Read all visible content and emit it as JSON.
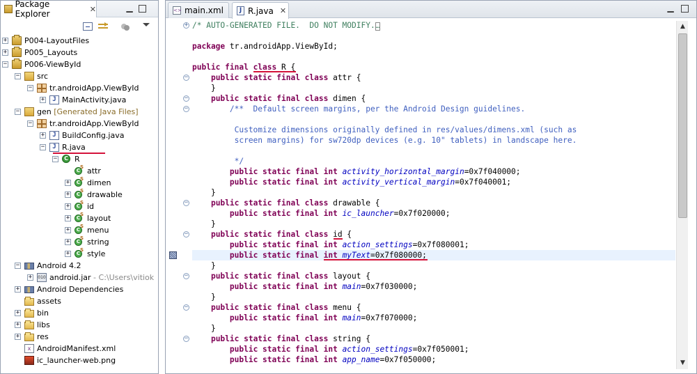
{
  "package_explorer": {
    "title": "Package Explorer",
    "tree": [
      {
        "level": 0,
        "toggle": "+",
        "icon": "project-icon",
        "label": "P004-LayoutFiles"
      },
      {
        "level": 0,
        "toggle": "+",
        "icon": "project-icon",
        "label": "P005_Layouts"
      },
      {
        "level": 0,
        "toggle": "-",
        "icon": "project-icon",
        "label": "P006-ViewById"
      },
      {
        "level": 1,
        "toggle": "-",
        "icon": "source-folder-icon",
        "label": "src"
      },
      {
        "level": 2,
        "toggle": "-",
        "icon": "package-icon",
        "label": "tr.androidApp.ViewById"
      },
      {
        "level": 3,
        "toggle": "+",
        "icon": "java-file-icon",
        "label": "MainActivity.java"
      },
      {
        "level": 1,
        "toggle": "-",
        "icon": "source-folder-icon",
        "label": "gen",
        "decoration": "[Generated Java Files]"
      },
      {
        "level": 2,
        "toggle": "-",
        "icon": "package-icon",
        "label": "tr.androidApp.ViewById"
      },
      {
        "level": 3,
        "toggle": "+",
        "icon": "java-file-icon",
        "label": "BuildConfig.java"
      },
      {
        "level": 3,
        "toggle": "-",
        "icon": "java-file-icon",
        "label": "R.java"
      },
      {
        "level": 4,
        "toggle": "-",
        "icon": "class-icon",
        "label": "R"
      },
      {
        "level": 5,
        "toggle": "",
        "icon": "inner-class-icon",
        "label": "attr"
      },
      {
        "level": 5,
        "toggle": "+",
        "icon": "inner-class-icon",
        "label": "dimen"
      },
      {
        "level": 5,
        "toggle": "+",
        "icon": "inner-class-icon",
        "label": "drawable"
      },
      {
        "level": 5,
        "toggle": "+",
        "icon": "inner-class-icon",
        "label": "id"
      },
      {
        "level": 5,
        "toggle": "+",
        "icon": "inner-class-icon",
        "label": "layout"
      },
      {
        "level": 5,
        "toggle": "+",
        "icon": "inner-class-icon",
        "label": "menu"
      },
      {
        "level": 5,
        "toggle": "+",
        "icon": "inner-class-icon",
        "label": "string"
      },
      {
        "level": 5,
        "toggle": "+",
        "icon": "inner-class-icon",
        "label": "style"
      },
      {
        "level": 1,
        "toggle": "-",
        "icon": "library-icon",
        "label": "Android 4.2"
      },
      {
        "level": 2,
        "toggle": "+",
        "icon": "jar-icon",
        "label": "android.jar",
        "decoration_grey": " - C:\\Users\\vitiok"
      },
      {
        "level": 1,
        "toggle": "+",
        "icon": "library-icon",
        "label": "Android Dependencies"
      },
      {
        "level": 1,
        "toggle": "",
        "icon": "folder-icon",
        "label": "assets"
      },
      {
        "level": 1,
        "toggle": "+",
        "icon": "folder-icon",
        "label": "bin"
      },
      {
        "level": 1,
        "toggle": "+",
        "icon": "folder-icon",
        "label": "libs"
      },
      {
        "level": 1,
        "toggle": "+",
        "icon": "folder-icon",
        "label": "res"
      },
      {
        "level": 1,
        "toggle": "",
        "icon": "xml-file-icon",
        "label": "AndroidManifest.xml"
      },
      {
        "level": 1,
        "toggle": "",
        "icon": "png-file-icon",
        "label": "ic_launcher-web.png"
      }
    ]
  },
  "editor": {
    "tabs": [
      {
        "label": "main.xml",
        "active": false
      },
      {
        "label": "R.java",
        "active": true
      }
    ],
    "lines": [
      [
        {
          "t": "/* AUTO-GENERATED FILE.  DO NOT MODIFY.",
          "c": "cmt"
        },
        {
          "t": "…",
          "c": "cmt"
        }
      ],
      [],
      [
        {
          "t": "package",
          "c": "kw"
        },
        {
          "t": " tr.androidApp.ViewById;",
          "c": ""
        }
      ],
      [],
      [
        {
          "t": "public final ",
          "c": "kw"
        },
        {
          "t": "class",
          "c": "kw"
        },
        {
          "t": " R {",
          "c": ""
        }
      ],
      [
        {
          "t": "    ",
          "c": ""
        },
        {
          "t": "public static final class",
          "c": "kw"
        },
        {
          "t": " attr {",
          "c": ""
        }
      ],
      [
        {
          "t": "    }",
          "c": ""
        }
      ],
      [
        {
          "t": "    ",
          "c": ""
        },
        {
          "t": "public static final class",
          "c": "kw"
        },
        {
          "t": " dimen {",
          "c": ""
        }
      ],
      [
        {
          "t": "        /**  Default screen margins, per the Android Design guidelines.",
          "c": "cm"
        }
      ],
      [],
      [
        {
          "t": "         Customize dimensions originally defined in res/values/dimens.xml (such as",
          "c": "cm"
        }
      ],
      [
        {
          "t": "         screen margins) for sw720dp devices (e.g. 10\" tablets) in landscape here.",
          "c": "cm"
        }
      ],
      [],
      [
        {
          "t": "         */",
          "c": "cm"
        }
      ],
      [
        {
          "t": "        ",
          "c": ""
        },
        {
          "t": "public static final int",
          "c": "kw"
        },
        {
          "t": " ",
          "c": ""
        },
        {
          "t": "activity_horizontal_margin",
          "c": "fld"
        },
        {
          "t": "=0x7f040000;",
          "c": ""
        }
      ],
      [
        {
          "t": "        ",
          "c": ""
        },
        {
          "t": "public static final int",
          "c": "kw"
        },
        {
          "t": " ",
          "c": ""
        },
        {
          "t": "activity_vertical_margin",
          "c": "fld"
        },
        {
          "t": "=0x7f040001;",
          "c": ""
        }
      ],
      [
        {
          "t": "    }",
          "c": ""
        }
      ],
      [
        {
          "t": "    ",
          "c": ""
        },
        {
          "t": "public static final class",
          "c": "kw"
        },
        {
          "t": " drawable {",
          "c": ""
        }
      ],
      [
        {
          "t": "        ",
          "c": ""
        },
        {
          "t": "public static final int",
          "c": "kw"
        },
        {
          "t": " ",
          "c": ""
        },
        {
          "t": "ic_launcher",
          "c": "fld"
        },
        {
          "t": "=0x7f020000;",
          "c": ""
        }
      ],
      [
        {
          "t": "    }",
          "c": ""
        }
      ],
      [
        {
          "t": "    ",
          "c": ""
        },
        {
          "t": "public static final class",
          "c": "kw"
        },
        {
          "t": " id {",
          "c": ""
        }
      ],
      [
        {
          "t": "        ",
          "c": ""
        },
        {
          "t": "public static final int",
          "c": "kw"
        },
        {
          "t": " ",
          "c": ""
        },
        {
          "t": "action_settings",
          "c": "fld"
        },
        {
          "t": "=0x7f080001;",
          "c": ""
        }
      ],
      [
        {
          "t": "        ",
          "c": ""
        },
        {
          "t": "public static final int",
          "c": "kw"
        },
        {
          "t": " ",
          "c": ""
        },
        {
          "t": "myText",
          "c": "fld"
        },
        {
          "t": "=0x7f080000;",
          "c": ""
        }
      ],
      [
        {
          "t": "    }",
          "c": ""
        }
      ],
      [
        {
          "t": "    ",
          "c": ""
        },
        {
          "t": "public static final class",
          "c": "kw"
        },
        {
          "t": " layout {",
          "c": ""
        }
      ],
      [
        {
          "t": "        ",
          "c": ""
        },
        {
          "t": "public static final int",
          "c": "kw"
        },
        {
          "t": " ",
          "c": ""
        },
        {
          "t": "main",
          "c": "fld"
        },
        {
          "t": "=0x7f030000;",
          "c": ""
        }
      ],
      [
        {
          "t": "    }",
          "c": ""
        }
      ],
      [
        {
          "t": "    ",
          "c": ""
        },
        {
          "t": "public static final class",
          "c": "kw"
        },
        {
          "t": " menu {",
          "c": ""
        }
      ],
      [
        {
          "t": "        ",
          "c": ""
        },
        {
          "t": "public static final int",
          "c": "kw"
        },
        {
          "t": " ",
          "c": ""
        },
        {
          "t": "main",
          "c": "fld"
        },
        {
          "t": "=0x7f070000;",
          "c": ""
        }
      ],
      [
        {
          "t": "    }",
          "c": ""
        }
      ],
      [
        {
          "t": "    ",
          "c": ""
        },
        {
          "t": "public static final class",
          "c": "kw"
        },
        {
          "t": " string {",
          "c": ""
        }
      ],
      [
        {
          "t": "        ",
          "c": ""
        },
        {
          "t": "public static final int",
          "c": "kw"
        },
        {
          "t": " ",
          "c": ""
        },
        {
          "t": "action_settings",
          "c": "fld"
        },
        {
          "t": "=0x7f050001;",
          "c": ""
        }
      ],
      [
        {
          "t": "        ",
          "c": ""
        },
        {
          "t": "public static final int",
          "c": "kw"
        },
        {
          "t": " ",
          "c": ""
        },
        {
          "t": "app_name",
          "c": "fld"
        },
        {
          "t": "=0x7f050000;",
          "c": ""
        }
      ]
    ],
    "folded_lines": [
      0
    ],
    "fold_markers_lines": [
      5,
      7,
      8,
      17,
      20,
      24,
      27,
      30
    ],
    "highlighted_line": 22
  },
  "colors": {
    "keyword": "#7f0055",
    "comment": "#3f7f5f",
    "javadoc": "#3f5fbf",
    "field": "#0000c0",
    "annotation_underline": "#d4123a",
    "current_line": "#e8f2fe"
  }
}
